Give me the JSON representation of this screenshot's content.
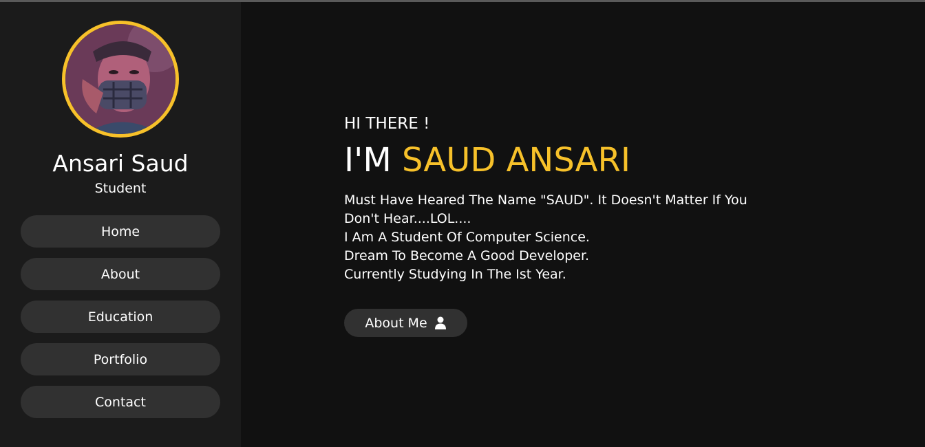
{
  "profile": {
    "name": "Ansari Saud",
    "role": "Student"
  },
  "nav": {
    "items": [
      {
        "label": "Home"
      },
      {
        "label": "About"
      },
      {
        "label": "Education"
      },
      {
        "label": "Portfolio"
      },
      {
        "label": "Contact"
      }
    ]
  },
  "hero": {
    "greeting": "HI THERE !",
    "prefix": "I'M",
    "name": "SAUD ANSARI",
    "bio": [
      "Must Have Heared The Name \"SAUD\". It Doesn't Matter If You Don't Hear....LOL....",
      "I Am A Student Of Computer Science.",
      "Dream To Become A Good Developer.",
      "Currently Studying In The Ist Year."
    ],
    "button_label": "About Me",
    "button_icon": "user-icon"
  },
  "colors": {
    "accent": "#f7c12a",
    "sidebar_bg": "#1b1b1b",
    "main_bg": "#111111",
    "button_bg": "#313131"
  }
}
